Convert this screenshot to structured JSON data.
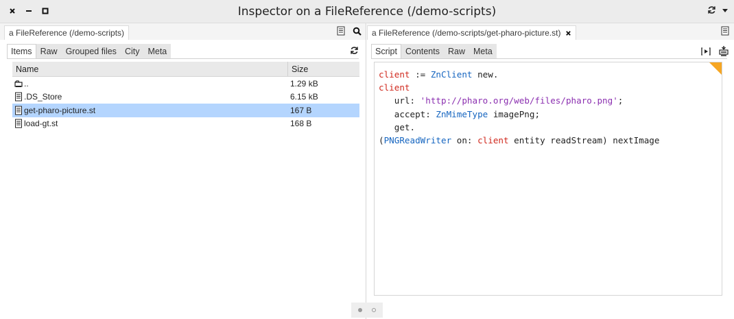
{
  "window": {
    "title": "Inspector on a FileReference (/demo-scripts)"
  },
  "left_pane": {
    "title": "a FileReference (/demo-scripts)",
    "tabs": [
      "Items",
      "Raw",
      "Grouped files",
      "City",
      "Meta"
    ],
    "active_tab": "Items",
    "table": {
      "columns": [
        "Name",
        "Size"
      ],
      "rows": [
        {
          "name": "..",
          "size": "1.29 kB",
          "icon": "folder-icon"
        },
        {
          "name": ".DS_Store",
          "size": "6.15 kB",
          "icon": "file-icon"
        },
        {
          "name": "get-pharo-picture.st",
          "size": "167 B",
          "icon": "file-icon",
          "selected": true
        },
        {
          "name": "load-gt.st",
          "size": "168 B",
          "icon": "file-icon"
        }
      ]
    }
  },
  "right_pane": {
    "title": "a FileReference (/demo-scripts/get-pharo-picture.st)",
    "tabs": [
      "Script",
      "Contents",
      "Raw",
      "Meta"
    ],
    "active_tab": "Script",
    "code_lines": [
      "client := ZnClient new.",
      "client",
      "   url: 'http://pharo.org/web/files/pharo.png';",
      "   accept: ZnMimeType imagePng;",
      "   get.",
      "(PNGReadWriter on: client entity readStream) nextImage"
    ]
  },
  "colors": {
    "selection": "#b4d5fe",
    "keyword": "#d0281d",
    "class_name": "#1565c0",
    "string": "#8b2fb0",
    "corner_accent": "#f6a623"
  }
}
